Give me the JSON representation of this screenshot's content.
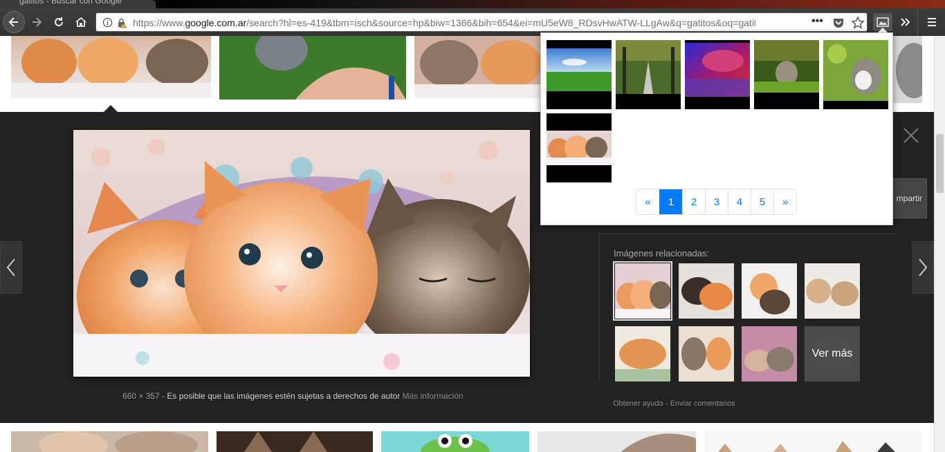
{
  "browser": {
    "tab_title": "gatitos - Buscar con Google",
    "url_prefix": "https://www.",
    "url_domain": "google.com.ar",
    "url_rest": "/search?hl=es-419&tbm=isch&source=hp&biw=1366&bih=654&ei=mU5eW8_RDsvHwATW-LLgAw&q=gatitos&oq=gatitos&",
    "colors": {
      "chrome_bg": "#333333",
      "url_bg": "#ffffff"
    }
  },
  "viewer": {
    "caption_size": "660 × 357",
    "caption_sep": "-",
    "caption_copyright": "Es posible que las imágenes estén sujetas a derechos de autor",
    "caption_more": "Más información",
    "share_label": "mpartir",
    "related_title": "Imágenes relacionadas:",
    "ver_mas": "Ver más",
    "footer_help": "Obtener ayuda",
    "footer_sep": "-",
    "footer_feedback": "Enviar comentarios",
    "colors": {
      "panel_bg": "#222222"
    }
  },
  "popup": {
    "thumbnails": [
      "sky-field",
      "tree-road",
      "purple-lake",
      "kitten-grass",
      "kitten-leaves",
      "kittens-blanket"
    ],
    "pagination": {
      "prev": "«",
      "pages": [
        "1",
        "2",
        "3",
        "4",
        "5"
      ],
      "next": "»",
      "active": "1"
    },
    "colors": {
      "accent": "#007bff"
    }
  }
}
